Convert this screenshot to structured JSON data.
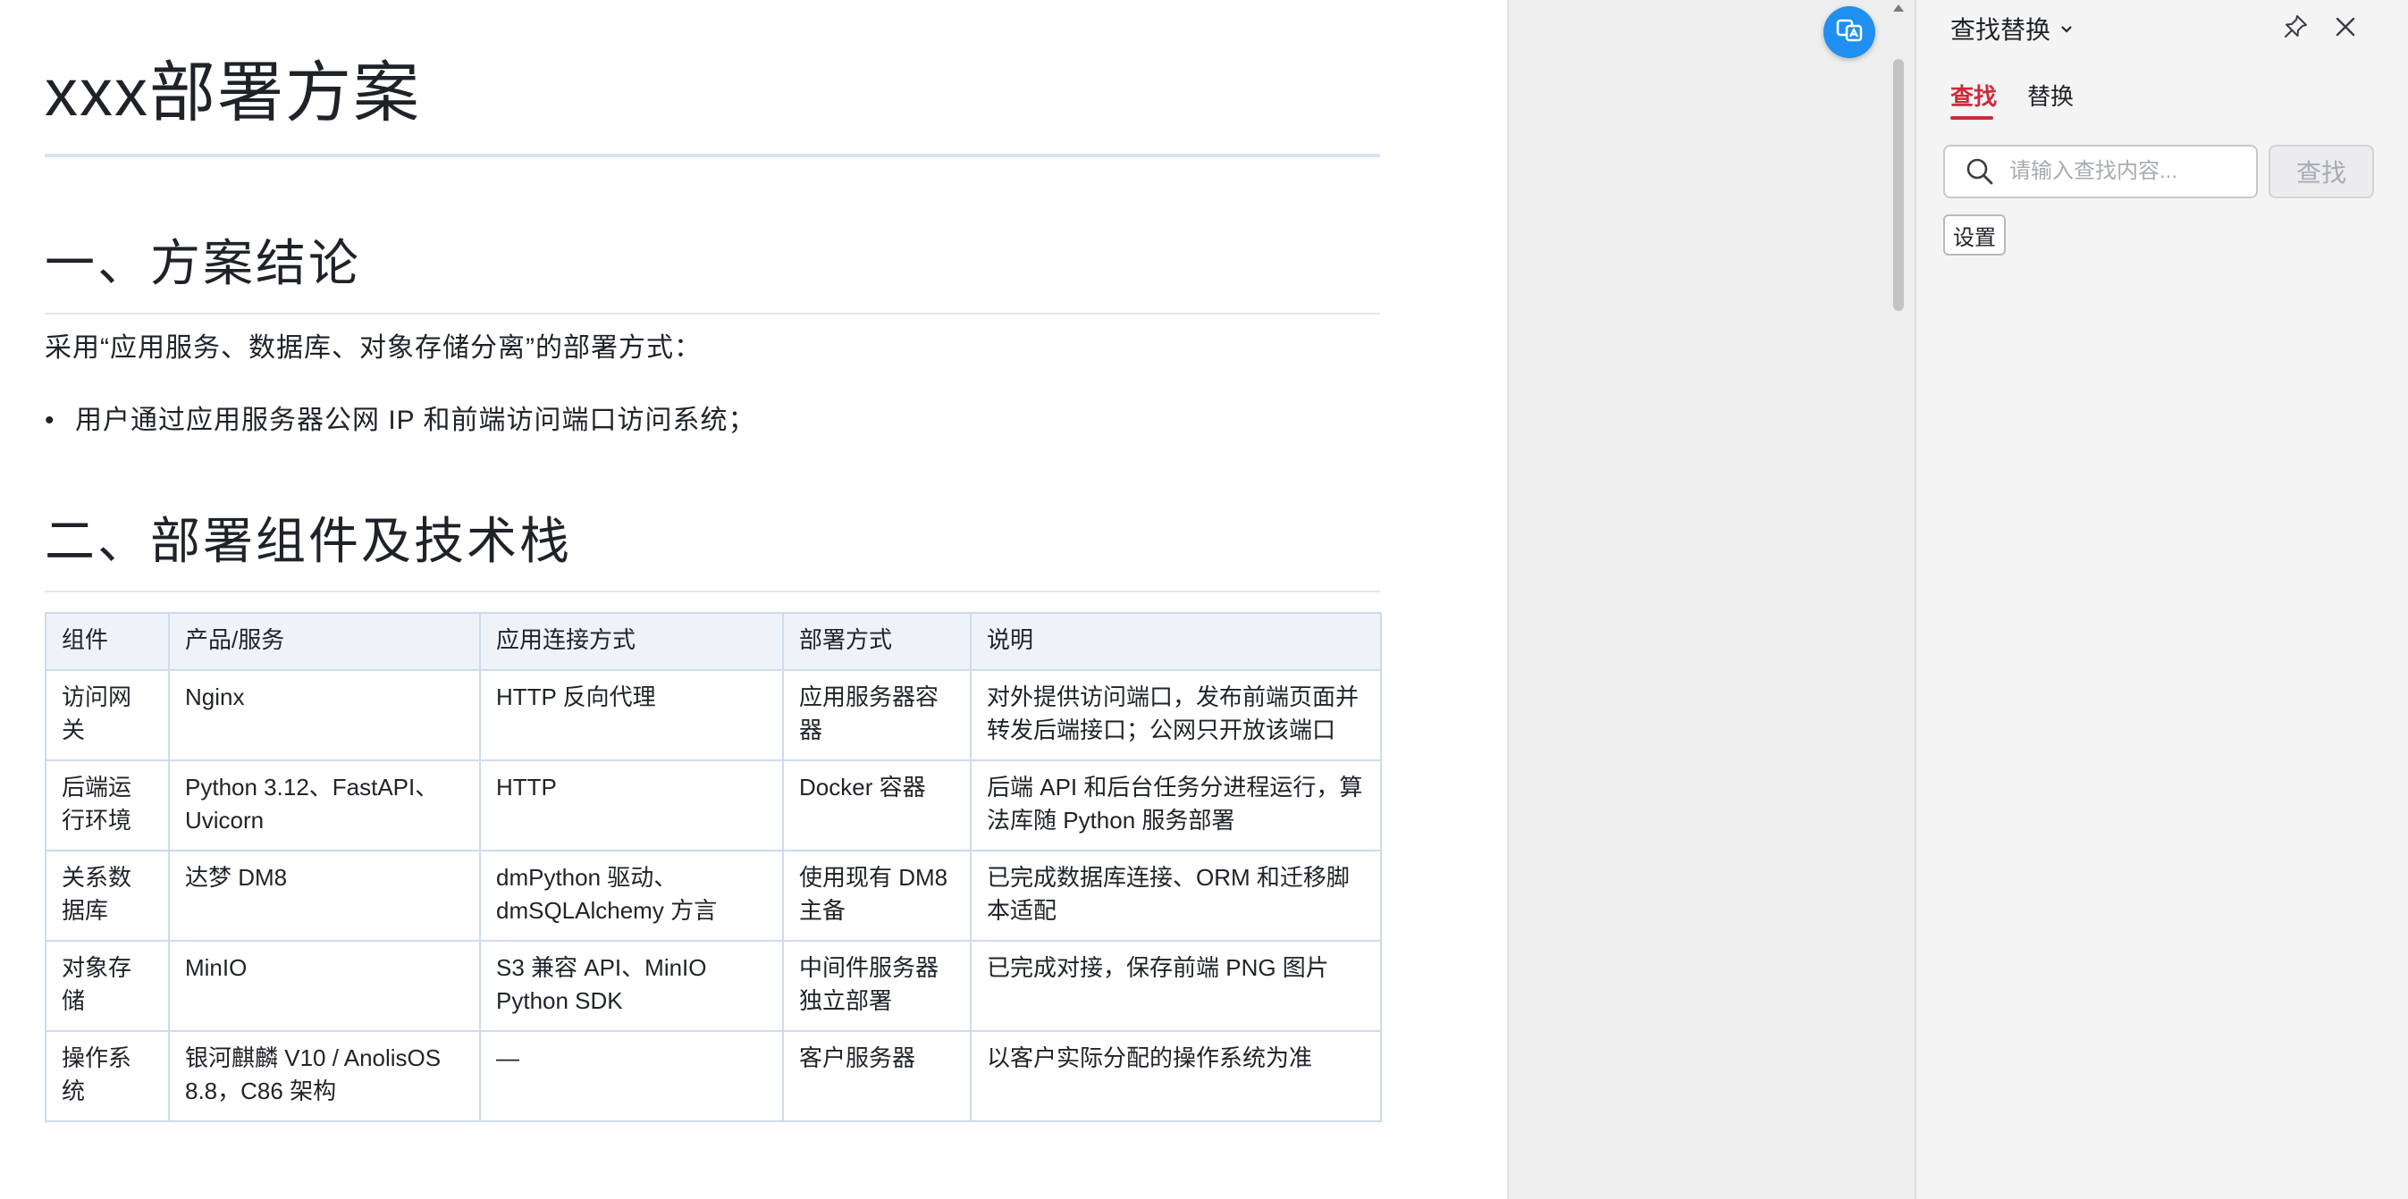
{
  "document": {
    "title": "xxx部署方案",
    "section1": {
      "heading": "一、方案结论",
      "paragraph": "采用“应用服务、数据库、对象存储分离”的部署方式：",
      "bullets": [
        "用户通过应用服务器公网 IP 和前端访问端口访问系统；"
      ]
    },
    "section2": {
      "heading": "二、部署组件及技术栈",
      "table": {
        "headers": [
          "组件",
          "产品/服务",
          "应用连接方式",
          "部署方式",
          "说明"
        ],
        "rows": [
          [
            "访问网关",
            "Nginx",
            "HTTP 反向代理",
            "应用服务器容器",
            "对外提供访问端口，发布前端页面并转发后端接口；公网只开放该端口"
          ],
          [
            "后端运行环境",
            "Python 3.12、FastAPI、Uvicorn",
            "HTTP",
            "Docker 容器",
            "后端 API 和后台任务分进程运行，算法库随 Python 服务部署"
          ],
          [
            "关系数据库",
            "达梦 DM8",
            "dmPython 驱动、dmSQLAlchemy 方言",
            "使用现有 DM8 主备",
            "已完成数据库连接、ORM 和迁移脚本适配"
          ],
          [
            "对象存储",
            "MinIO",
            "S3 兼容 API、MinIO Python SDK",
            "中间件服务器独立部署",
            "已完成对接，保存前端 PNG 图片"
          ],
          [
            "操作系统",
            "银河麒麟 V10 / AnolisOS 8.8，C86 架构",
            "—",
            "客户服务器",
            "以客户实际分配的操作系统为准"
          ]
        ]
      }
    }
  },
  "panel": {
    "title": "查找替换",
    "tabs": {
      "find": "查找",
      "replace": "替换"
    },
    "search": {
      "placeholder": "请输入查找内容...",
      "value": ""
    },
    "find_button": "查找",
    "settings_button": "设置"
  },
  "icons": {
    "float_button": "translate-icon",
    "title_dropdown": "chevron-down-icon",
    "pin": "pin-icon",
    "close": "close-icon",
    "search": "search-icon",
    "scroll_up": "scroll-up-arrow-icon"
  },
  "colors": {
    "accent": "#cc2a3b",
    "float_button": "#1f8ff1",
    "table_border": "#cfdbea",
    "table_header_bg": "#eef3fa"
  }
}
